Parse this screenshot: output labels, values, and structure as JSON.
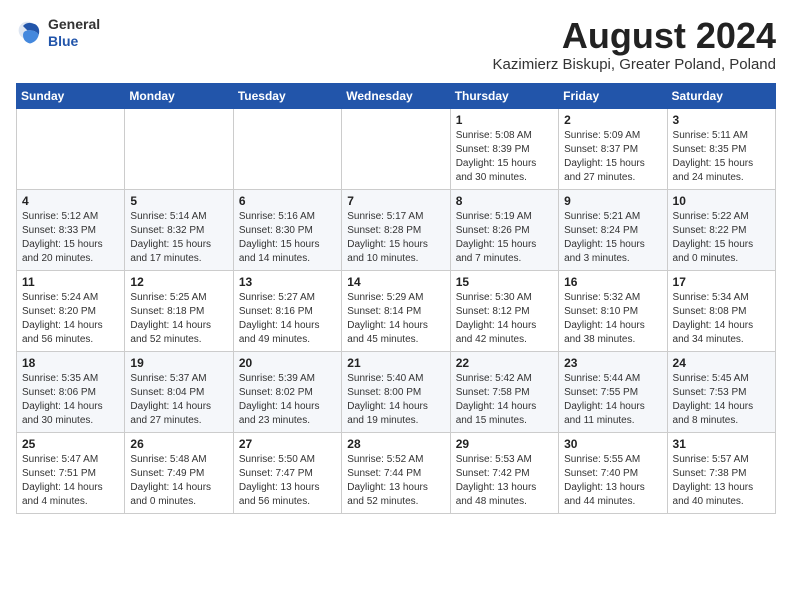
{
  "header": {
    "logo_general": "General",
    "logo_blue": "Blue",
    "month_year": "August 2024",
    "location": "Kazimierz Biskupi, Greater Poland, Poland"
  },
  "weekdays": [
    "Sunday",
    "Monday",
    "Tuesday",
    "Wednesday",
    "Thursday",
    "Friday",
    "Saturday"
  ],
  "weeks": [
    [
      {
        "day": "",
        "info": ""
      },
      {
        "day": "",
        "info": ""
      },
      {
        "day": "",
        "info": ""
      },
      {
        "day": "",
        "info": ""
      },
      {
        "day": "1",
        "info": "Sunrise: 5:08 AM\nSunset: 8:39 PM\nDaylight: 15 hours\nand 30 minutes."
      },
      {
        "day": "2",
        "info": "Sunrise: 5:09 AM\nSunset: 8:37 PM\nDaylight: 15 hours\nand 27 minutes."
      },
      {
        "day": "3",
        "info": "Sunrise: 5:11 AM\nSunset: 8:35 PM\nDaylight: 15 hours\nand 24 minutes."
      }
    ],
    [
      {
        "day": "4",
        "info": "Sunrise: 5:12 AM\nSunset: 8:33 PM\nDaylight: 15 hours\nand 20 minutes."
      },
      {
        "day": "5",
        "info": "Sunrise: 5:14 AM\nSunset: 8:32 PM\nDaylight: 15 hours\nand 17 minutes."
      },
      {
        "day": "6",
        "info": "Sunrise: 5:16 AM\nSunset: 8:30 PM\nDaylight: 15 hours\nand 14 minutes."
      },
      {
        "day": "7",
        "info": "Sunrise: 5:17 AM\nSunset: 8:28 PM\nDaylight: 15 hours\nand 10 minutes."
      },
      {
        "day": "8",
        "info": "Sunrise: 5:19 AM\nSunset: 8:26 PM\nDaylight: 15 hours\nand 7 minutes."
      },
      {
        "day": "9",
        "info": "Sunrise: 5:21 AM\nSunset: 8:24 PM\nDaylight: 15 hours\nand 3 minutes."
      },
      {
        "day": "10",
        "info": "Sunrise: 5:22 AM\nSunset: 8:22 PM\nDaylight: 15 hours\nand 0 minutes."
      }
    ],
    [
      {
        "day": "11",
        "info": "Sunrise: 5:24 AM\nSunset: 8:20 PM\nDaylight: 14 hours\nand 56 minutes."
      },
      {
        "day": "12",
        "info": "Sunrise: 5:25 AM\nSunset: 8:18 PM\nDaylight: 14 hours\nand 52 minutes."
      },
      {
        "day": "13",
        "info": "Sunrise: 5:27 AM\nSunset: 8:16 PM\nDaylight: 14 hours\nand 49 minutes."
      },
      {
        "day": "14",
        "info": "Sunrise: 5:29 AM\nSunset: 8:14 PM\nDaylight: 14 hours\nand 45 minutes."
      },
      {
        "day": "15",
        "info": "Sunrise: 5:30 AM\nSunset: 8:12 PM\nDaylight: 14 hours\nand 42 minutes."
      },
      {
        "day": "16",
        "info": "Sunrise: 5:32 AM\nSunset: 8:10 PM\nDaylight: 14 hours\nand 38 minutes."
      },
      {
        "day": "17",
        "info": "Sunrise: 5:34 AM\nSunset: 8:08 PM\nDaylight: 14 hours\nand 34 minutes."
      }
    ],
    [
      {
        "day": "18",
        "info": "Sunrise: 5:35 AM\nSunset: 8:06 PM\nDaylight: 14 hours\nand 30 minutes."
      },
      {
        "day": "19",
        "info": "Sunrise: 5:37 AM\nSunset: 8:04 PM\nDaylight: 14 hours\nand 27 minutes."
      },
      {
        "day": "20",
        "info": "Sunrise: 5:39 AM\nSunset: 8:02 PM\nDaylight: 14 hours\nand 23 minutes."
      },
      {
        "day": "21",
        "info": "Sunrise: 5:40 AM\nSunset: 8:00 PM\nDaylight: 14 hours\nand 19 minutes."
      },
      {
        "day": "22",
        "info": "Sunrise: 5:42 AM\nSunset: 7:58 PM\nDaylight: 14 hours\nand 15 minutes."
      },
      {
        "day": "23",
        "info": "Sunrise: 5:44 AM\nSunset: 7:55 PM\nDaylight: 14 hours\nand 11 minutes."
      },
      {
        "day": "24",
        "info": "Sunrise: 5:45 AM\nSunset: 7:53 PM\nDaylight: 14 hours\nand 8 minutes."
      }
    ],
    [
      {
        "day": "25",
        "info": "Sunrise: 5:47 AM\nSunset: 7:51 PM\nDaylight: 14 hours\nand 4 minutes."
      },
      {
        "day": "26",
        "info": "Sunrise: 5:48 AM\nSunset: 7:49 PM\nDaylight: 14 hours\nand 0 minutes."
      },
      {
        "day": "27",
        "info": "Sunrise: 5:50 AM\nSunset: 7:47 PM\nDaylight: 13 hours\nand 56 minutes."
      },
      {
        "day": "28",
        "info": "Sunrise: 5:52 AM\nSunset: 7:44 PM\nDaylight: 13 hours\nand 52 minutes."
      },
      {
        "day": "29",
        "info": "Sunrise: 5:53 AM\nSunset: 7:42 PM\nDaylight: 13 hours\nand 48 minutes."
      },
      {
        "day": "30",
        "info": "Sunrise: 5:55 AM\nSunset: 7:40 PM\nDaylight: 13 hours\nand 44 minutes."
      },
      {
        "day": "31",
        "info": "Sunrise: 5:57 AM\nSunset: 7:38 PM\nDaylight: 13 hours\nand 40 minutes."
      }
    ]
  ]
}
